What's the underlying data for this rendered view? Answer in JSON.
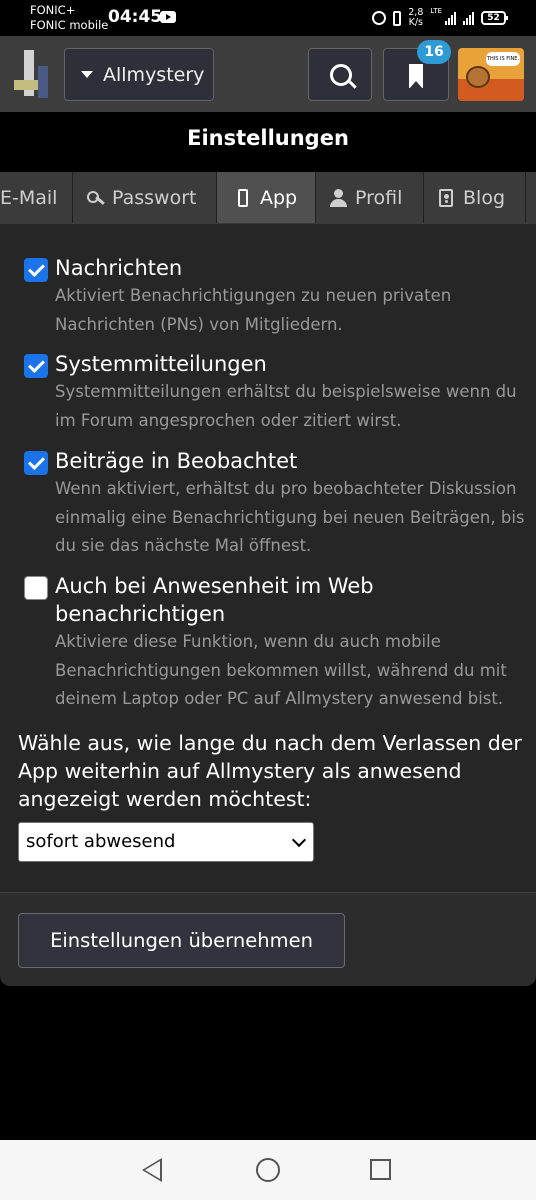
{
  "status_bar": {
    "carrier_1": "FONIC+",
    "carrier_2": "FONIC mobile",
    "time": "04:45",
    "speed_value": "2,8",
    "speed_unit": "K/s",
    "network": "LTE",
    "battery": "52"
  },
  "header": {
    "site_name": "Allmystery",
    "bookmark_count": "16",
    "avatar_text": "THIS IS FINE."
  },
  "page": {
    "title": "Einstellungen"
  },
  "tabs": [
    {
      "label": "E-Mail",
      "active": false
    },
    {
      "label": "Passwort",
      "active": false
    },
    {
      "label": "App",
      "active": true
    },
    {
      "label": "Profil",
      "active": false
    },
    {
      "label": "Blog",
      "active": false
    }
  ],
  "options": [
    {
      "label": "Nachrichten",
      "checked": true,
      "description": "Aktiviert Benachrichtigungen zu neuen privaten Nachrichten (PNs) von Mitgliedern."
    },
    {
      "label": "Systemmitteilungen",
      "checked": true,
      "description": "Systemmitteilungen erhältst du beispielsweise wenn du im Forum angesprochen oder zitiert wirst."
    },
    {
      "label": "Beiträge in Beobachtet",
      "checked": true,
      "description": "Wenn aktiviert, erhältst du pro beobachteter Diskussion einmalig eine Benachrichtigung bei neuen Beiträgen, bis du sie das nächste Mal öffnest."
    },
    {
      "label": "Auch bei Anwesenheit im Web benachrichtigen",
      "checked": false,
      "description": "Aktiviere diese Funktion, wenn du auch mobile Benachrichtigungen bekommen willst, während du mit deinem Laptop oder PC auf Allmystery anwesend bist."
    }
  ],
  "presence": {
    "question": "Wähle aus, wie lange du nach dem Verlassen der App weiterhin auf Allmystery als anwesend angezeigt werden möchtest:",
    "selected": "sofort abwesend"
  },
  "actions": {
    "apply_label": "Einstellungen übernehmen"
  },
  "icons": {
    "search": "search-icon",
    "bookmark": "bookmark-icon",
    "key": "key-icon",
    "phone": "phone-icon",
    "user": "user-icon",
    "blog": "blog-icon"
  },
  "colors": {
    "checkbox_accent": "#1a73e8",
    "badge": "#2e9bd6"
  }
}
